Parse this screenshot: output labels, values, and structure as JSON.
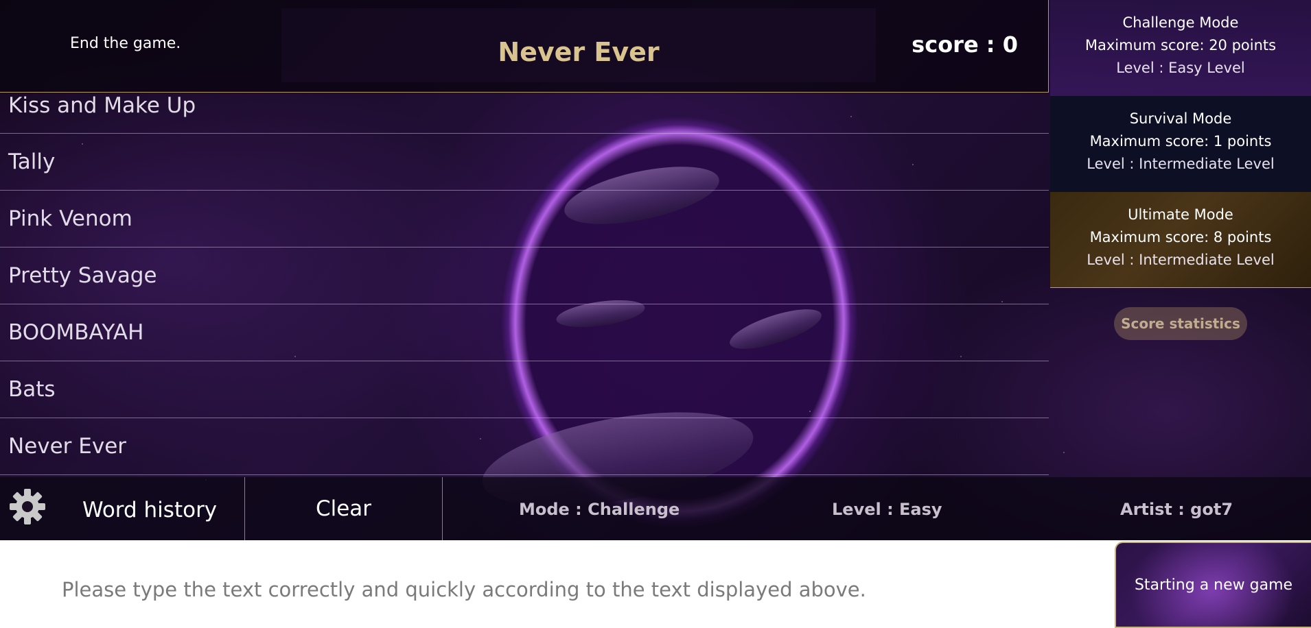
{
  "header": {
    "end_game": "End the game.",
    "current_word": "Never Ever",
    "score": "score : 0"
  },
  "words": [
    "Kiss and Make Up",
    "Tally",
    "Pink Venom",
    "Pretty Savage",
    "BOOMBAYAH",
    "Bats",
    "Never Ever"
  ],
  "modes": [
    {
      "name": "Challenge Mode",
      "max": "Maximum score: 20 points",
      "level": "Level : Easy Level"
    },
    {
      "name": "Survival Mode",
      "max": "Maximum score: 1 points",
      "level": "Level : Intermediate Level"
    },
    {
      "name": "Ultimate Mode",
      "max": "Maximum score: 8 points",
      "level": "Level : Intermediate Level"
    }
  ],
  "score_statistics": "Score statistics",
  "toolbar": {
    "settings_icon": "gear-icon",
    "word_history": "Word history",
    "clear": "Clear",
    "mode": "Mode : Challenge",
    "level": "Level : Easy",
    "artist": "Artist : got7"
  },
  "input": {
    "placeholder": "Please type the text correctly and quickly according to the text displayed above.",
    "value": ""
  },
  "new_game": "Starting a new game",
  "colors": {
    "accent_gold": "#d9c48f",
    "border_gold": "#b89a66",
    "space_purple": "#24103a"
  }
}
